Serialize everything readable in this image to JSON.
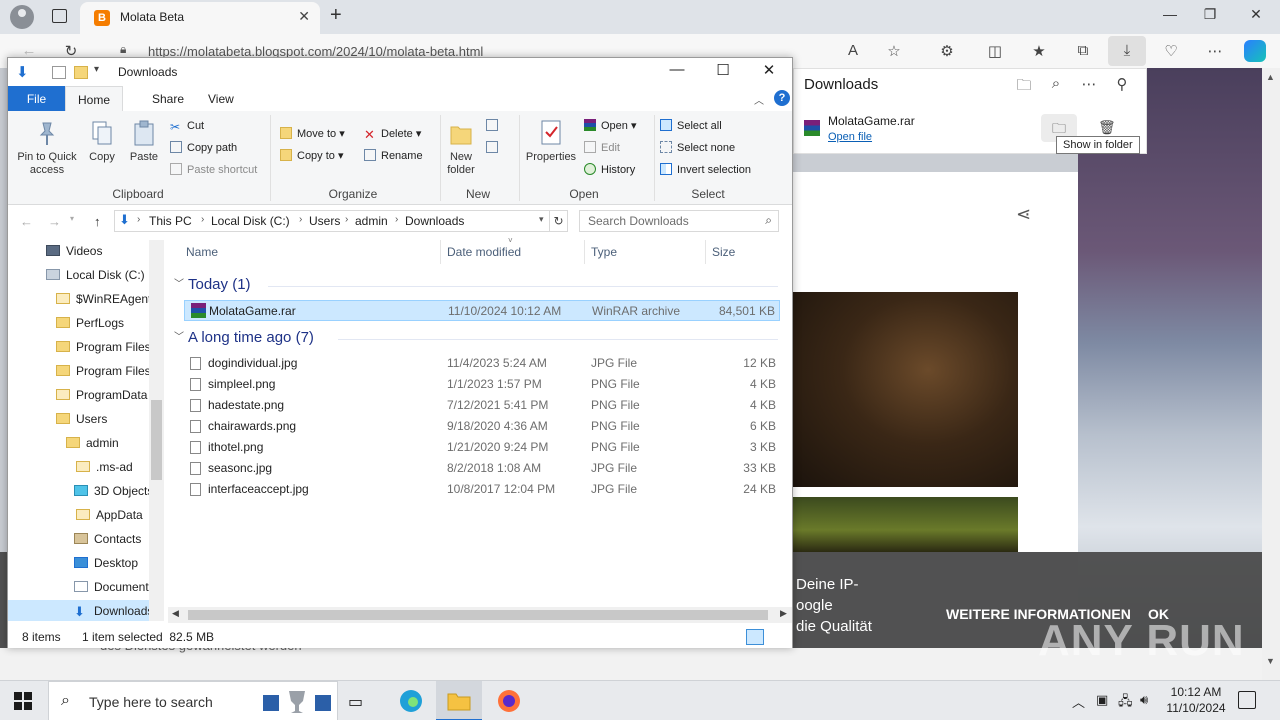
{
  "browser": {
    "tab_title": "Molata Beta",
    "url": "https://molatabeta.blogspot.com/2024/10/molata-beta.html"
  },
  "downloads_panel": {
    "title": "Downloads",
    "file_name": "MolataGame.rar",
    "open_link": "Open file",
    "tooltip": "Show in folder"
  },
  "page": {
    "cookie_text": "Deine IP-\noogle\ndie Qualität",
    "cookie_more": "WEITERE INFORMATIONEN",
    "cookie_ok": "OK",
    "under_text": "des Dienstes gewährleistet werden",
    "watermark": "ANY RUN"
  },
  "explorer": {
    "title": "Downloads",
    "tabs": [
      "File",
      "Home",
      "Share",
      "View"
    ],
    "ribbon": {
      "clipboard": {
        "label": "Clipboard",
        "pin": "Pin to Quick access",
        "copy": "Copy",
        "paste": "Paste",
        "cut": "Cut",
        "copy_path": "Copy path",
        "paste_shortcut": "Paste shortcut"
      },
      "organize": {
        "label": "Organize",
        "move_to": "Move to",
        "copy_to": "Copy to",
        "delete": "Delete",
        "rename": "Rename"
      },
      "new": {
        "label": "New",
        "new_folder": "New folder"
      },
      "open": {
        "label": "Open",
        "properties": "Properties",
        "open": "Open",
        "edit": "Edit",
        "history": "History"
      },
      "select": {
        "label": "Select",
        "select_all": "Select all",
        "select_none": "Select none",
        "invert": "Invert selection"
      }
    },
    "breadcrumbs": [
      "This PC",
      "Local Disk (C:)",
      "Users",
      "admin",
      "Downloads"
    ],
    "search_placeholder": "Search Downloads",
    "nav_items": [
      "Videos",
      "Local Disk (C:)",
      "$WinREAgent",
      "PerfLogs",
      "Program Files",
      "Program Files",
      "ProgramData",
      "Users",
      "admin",
      ".ms-ad",
      "3D Objects",
      "AppData",
      "Contacts",
      "Desktop",
      "Documents",
      "Downloads"
    ],
    "columns": [
      "Name",
      "Date modified",
      "Type",
      "Size"
    ],
    "groups": {
      "today": "Today (1)",
      "longago": "A long time ago (7)"
    },
    "today_files": [
      {
        "name": "MolataGame.rar",
        "date": "11/10/2024 10:12 AM",
        "type": "WinRAR archive",
        "size": "84,501 KB"
      }
    ],
    "old_files": [
      {
        "name": "dogindividual.jpg",
        "date": "11/4/2023 5:24 AM",
        "type": "JPG File",
        "size": "12 KB"
      },
      {
        "name": "simpleel.png",
        "date": "1/1/2023 1:57 PM",
        "type": "PNG File",
        "size": "4 KB"
      },
      {
        "name": "hadestate.png",
        "date": "7/12/2021 5:41 PM",
        "type": "PNG File",
        "size": "4 KB"
      },
      {
        "name": "chairawards.png",
        "date": "9/18/2020 4:36 AM",
        "type": "PNG File",
        "size": "6 KB"
      },
      {
        "name": "ithotel.png",
        "date": "1/21/2020 9:24 PM",
        "type": "PNG File",
        "size": "3 KB"
      },
      {
        "name": "seasonc.jpg",
        "date": "8/2/2018 1:08 AM",
        "type": "JPG File",
        "size": "33 KB"
      },
      {
        "name": "interfaceaccept.jpg",
        "date": "10/8/2017 12:04 PM",
        "type": "JPG File",
        "size": "24 KB"
      }
    ],
    "status": {
      "items": "8 items",
      "selected": "1 item selected  82.5 MB"
    }
  },
  "taskbar": {
    "search_placeholder": "Type here to search",
    "time": "10:12 AM",
    "date": "11/10/2024"
  }
}
